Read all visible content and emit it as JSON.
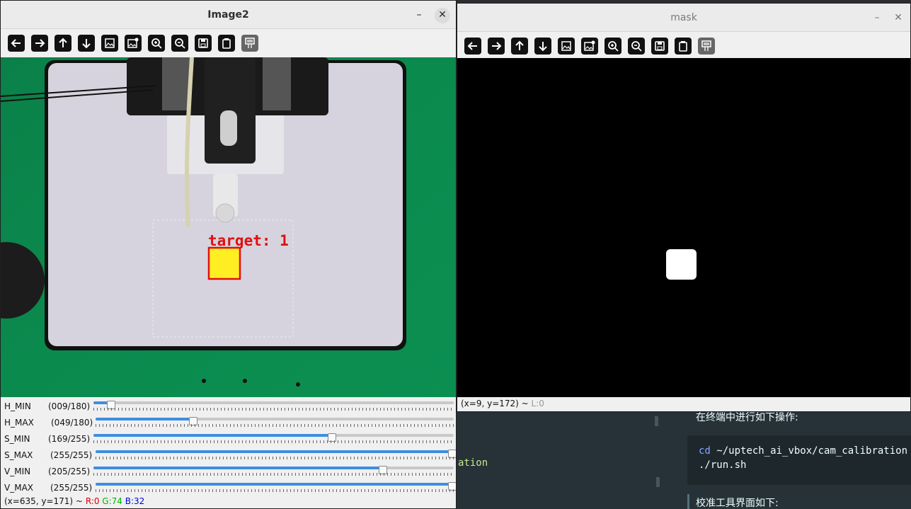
{
  "background": {
    "code_fragment": "ation",
    "doc_line1": "在终端中进行如下操作:",
    "code_cmd": "cd",
    "code_path": "~/uptech_ai_vbox/cam_calibration",
    "code_line2": "./run.sh",
    "doc_line2": "校准工具界面如下:"
  },
  "image_window": {
    "title": "Image2",
    "min_glyph": "–",
    "close_glyph": "✕",
    "overlay_label": "target: 1",
    "trackbars": [
      {
        "name": "H_MIN",
        "display": "(009/180)",
        "value": 9,
        "max": 180
      },
      {
        "name": "H_MAX",
        "display": "(049/180)",
        "value": 49,
        "max": 180
      },
      {
        "name": "S_MIN",
        "display": "(169/255)",
        "value": 169,
        "max": 255
      },
      {
        "name": "S_MAX",
        "display": "(255/255)",
        "value": 255,
        "max": 255
      },
      {
        "name": "V_MIN",
        "display": "(205/255)",
        "value": 205,
        "max": 255
      },
      {
        "name": "V_MAX",
        "display": "(255/255)",
        "value": 255,
        "max": 255
      }
    ],
    "status": {
      "coords": "(x=635, y=171) ~",
      "r": "R:0",
      "g": "G:74",
      "b": "B:32"
    }
  },
  "mask_window": {
    "title": "mask",
    "min_glyph": "–",
    "close_glyph": "✕",
    "status": {
      "coords": "(x=9, y=172) ~",
      "l": "L:0"
    }
  },
  "toolbar_icons": [
    "arrow-left-icon",
    "arrow-right-icon",
    "arrow-up-icon",
    "arrow-down-icon",
    "image-icon",
    "image-edit-icon",
    "zoom-in-icon",
    "zoom-out-icon",
    "save-icon",
    "clipboard-icon",
    "properties-icon"
  ],
  "colors": {
    "accent": "#3d8ee0",
    "mat": "#0b8a4e",
    "target_fill": "#ffee22",
    "target_border": "#e01010"
  }
}
